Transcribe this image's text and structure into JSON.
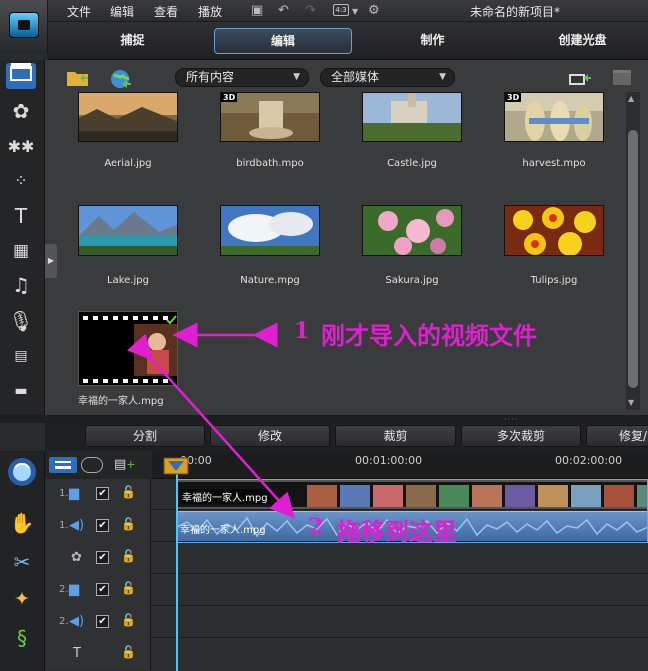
{
  "window": {
    "title": "未命名的新项目*"
  },
  "menu": {
    "file": "文件",
    "edit": "编辑",
    "view": "查看",
    "play": "播放",
    "ratio": "4:3"
  },
  "modes": {
    "capture": "捕捉",
    "edit": "编辑",
    "produce": "制作",
    "disc": "创建光盘"
  },
  "library": {
    "filter_content": "所有内容",
    "filter_media": "全部媒体",
    "items": [
      {
        "name": "Aerial.jpg",
        "badge": ""
      },
      {
        "name": "birdbath.mpo",
        "badge": "3D"
      },
      {
        "name": "Castle.jpg",
        "badge": ""
      },
      {
        "name": "harvest.mpo",
        "badge": "3D"
      },
      {
        "name": "Lake.jpg",
        "badge": ""
      },
      {
        "name": "Nature.mpg",
        "badge": ""
      },
      {
        "name": "Sakura.jpg",
        "badge": ""
      },
      {
        "name": "Tulips.jpg",
        "badge": ""
      },
      {
        "name": "幸福的一家人.mpg",
        "badge": ""
      }
    ]
  },
  "actions": {
    "split": "分割",
    "modify": "修改",
    "trim": "裁剪",
    "multi_trim": "多次裁剪",
    "fix": "修复/"
  },
  "timeline": {
    "ruler": [
      "00:00",
      "00:01:00:00",
      "00:02:00:00"
    ],
    "tracks": [
      {
        "num": "1.",
        "checked": "✔"
      },
      {
        "num": "1.",
        "checked": "✔"
      },
      {
        "num": "",
        "checked": "✔"
      },
      {
        "num": "2.",
        "checked": "✔"
      },
      {
        "num": "2.",
        "checked": "✔"
      },
      {
        "num": "",
        "checked": ""
      }
    ],
    "video_clip_name": "幸福的一家人.mpg",
    "audio_clip_name": "幸福的一家人.mpg"
  },
  "annotations": {
    "a1_num": "1",
    "a1_text": "刚才导入的视频文件",
    "a2_num": "2",
    "a2_text": "拖移到这里"
  },
  "colors": {
    "accent": "#2e6fb7",
    "annotation": "#e020d0",
    "playhead": "#45c8ff"
  }
}
